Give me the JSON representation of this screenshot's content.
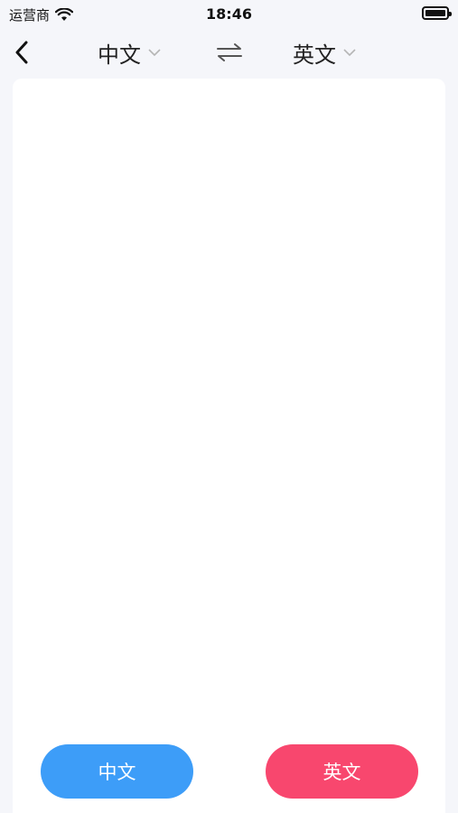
{
  "status_bar": {
    "carrier": "运营商",
    "time": "18:46",
    "icons": [
      "wifi-icon",
      "battery-icon"
    ]
  },
  "nav": {
    "back_icon": "chevron-left-icon",
    "source_language": "中文",
    "target_language": "英文",
    "dropdown_icon": "chevron-down-icon",
    "swap_icon": "swap-arrows-icon"
  },
  "translate_input": {
    "value": "",
    "placeholder": ""
  },
  "buttons": {
    "chinese_label": "中文",
    "english_label": "英文"
  },
  "colors": {
    "background": "#f5f6fa",
    "card": "#ffffff",
    "chinese_button": "#3d9df8",
    "english_button": "#f8476e",
    "chevron": "#b5b5b5"
  }
}
